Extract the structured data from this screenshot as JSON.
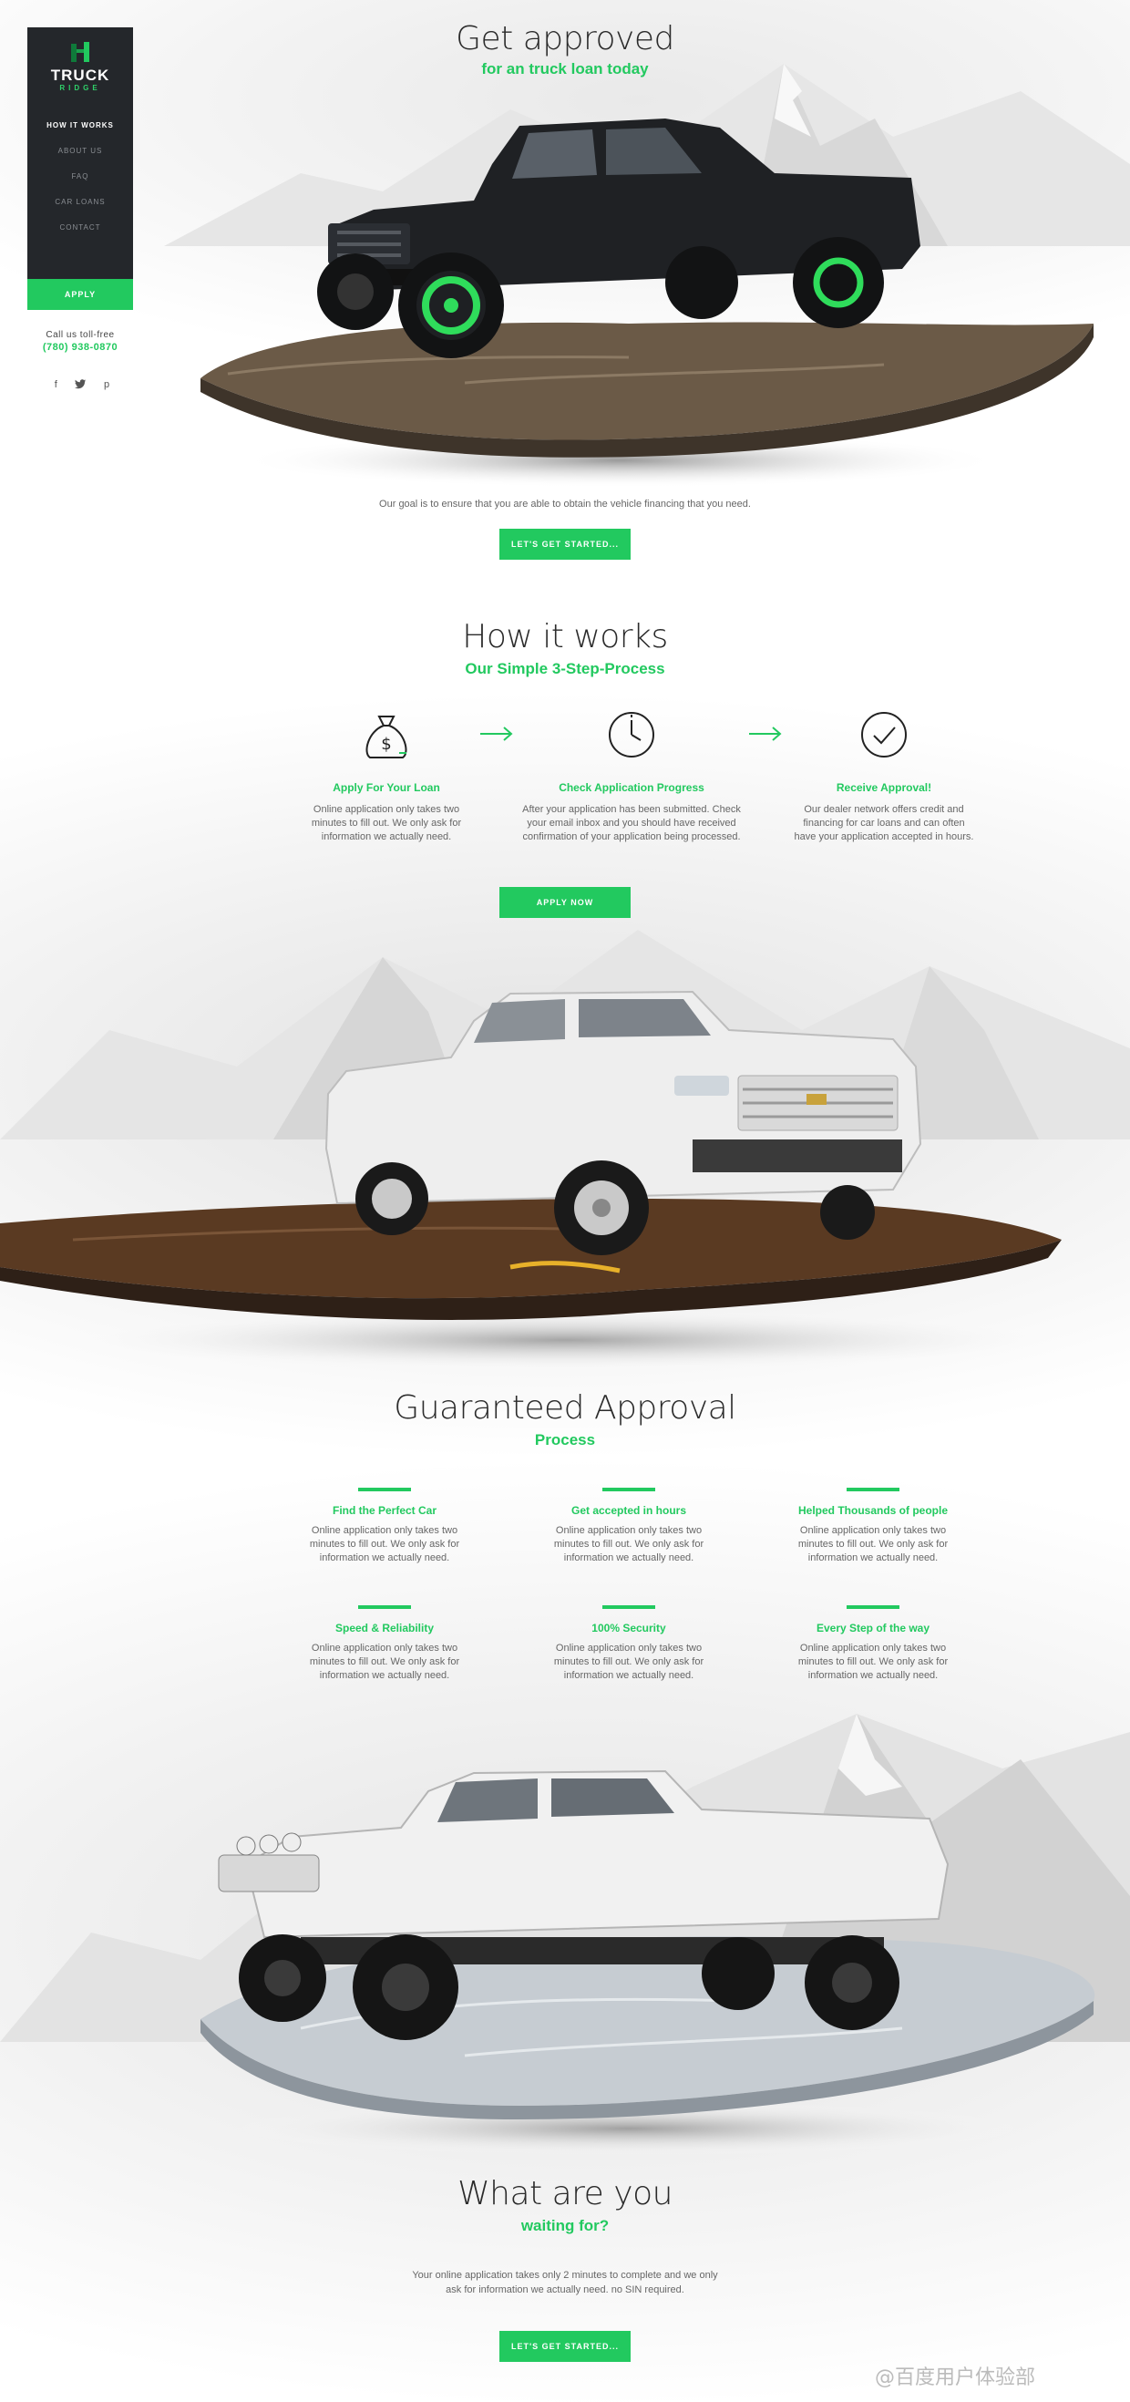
{
  "brand": {
    "name": "TRUCK",
    "sub": "RIDGE"
  },
  "nav": {
    "items": [
      "HOW IT WORKS",
      "ABOUT US",
      "FAQ",
      "CAR LOANS",
      "CONTACT"
    ],
    "apply": "APPLY"
  },
  "contact": {
    "label": "Call us toll-free",
    "phone": "(780) 938-0870"
  },
  "social": [
    "f",
    "twitter",
    "p"
  ],
  "hero": {
    "title": "Get approved",
    "subtitle": "for an truck loan today",
    "text": "Our goal is to ensure that you are able to obtain the vehicle financing that you need.",
    "cta": "LET'S GET STARTED..."
  },
  "how": {
    "title": "How it works",
    "subtitle": "Our Simple 3-Step-Process",
    "steps": [
      {
        "icon": "money-bag-icon",
        "title": "Apply For Your Loan",
        "text": "Online application only takes two minutes to fill out. We only ask for information we actually need."
      },
      {
        "icon": "clock-icon",
        "title": "Check Application Progress",
        "text": "After your application has been submitted. Check your email inbox and you should have received confirmation of your application being processed."
      },
      {
        "icon": "check-circle-icon",
        "title": "Receive Approval!",
        "text": "Our dealer network offers credit and financing for car loans and can often have your application accepted in hours."
      }
    ],
    "cta": "APPLY NOW"
  },
  "guarantee": {
    "title": "Guaranteed Approval",
    "subtitle": "Process",
    "features": [
      {
        "title": "Find the Perfect Car",
        "text": "Online application only takes two minutes to fill out. We only ask for information we actually need."
      },
      {
        "title": "Get accepted in hours",
        "text": "Online application only takes two minutes to fill out. We only ask for information we actually need."
      },
      {
        "title": "Helped Thousands of people",
        "text": "Online application only takes two minutes to fill out. We only ask for information we actually need."
      },
      {
        "title": "Speed & Reliability",
        "text": "Online application only takes two minutes to fill out. We only ask for information we actually need."
      },
      {
        "title": "100% Security",
        "text": "Online application only takes two minutes to fill out. We only ask for information we actually need."
      },
      {
        "title": "Every Step of the way",
        "text": "Online application only takes two minutes to fill out. We only ask for information we actually need."
      }
    ]
  },
  "waiting": {
    "title": "What are you",
    "subtitle": "waiting for?",
    "text1": "Your online application takes only 2 minutes to complete and we only",
    "text2": "ask for information we actually need. no SIN required.",
    "cta": "LET'S GET STARTED..."
  },
  "watermark": "@百度用户体验部",
  "colors": {
    "accent": "#22c95f",
    "sidebar": "#24272b"
  }
}
